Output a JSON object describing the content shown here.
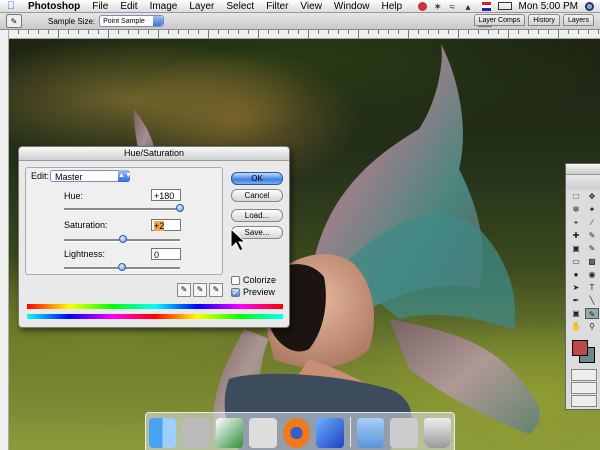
{
  "menubar": {
    "app_name": "Photoshop",
    "items": [
      "File",
      "Edit",
      "Image",
      "Layer",
      "Select",
      "Filter",
      "View",
      "Window",
      "Help"
    ],
    "clock": "Mon 5:00 PM"
  },
  "options_bar": {
    "sample_size_label": "Sample Size:",
    "sample_size_value": "Point Sample"
  },
  "palette_well": {
    "tabs": [
      "Layer Comps",
      "History",
      "Layers"
    ]
  },
  "dialog": {
    "title": "Hue/Saturation",
    "edit_label": "Edit:",
    "edit_value": "Master",
    "hue_label": "Hue:",
    "hue_value": "+180",
    "hue_level": 180,
    "saturation_label": "Saturation:",
    "saturation_value": "+2",
    "saturation_level": 2,
    "lightness_label": "Lightness:",
    "lightness_value": "0",
    "lightness_level": 0,
    "ok_label": "OK",
    "cancel_label": "Cancel",
    "load_label": "Load...",
    "save_label": "Save...",
    "colorize_label": "Colorize",
    "colorize_checked": false,
    "preview_label": "Preview",
    "preview_checked": true
  },
  "colors": {
    "foreground": "#bd4848",
    "background": "#6b8a8a",
    "accent": "#3f7fe0"
  },
  "dock_icons": [
    "finder-icon",
    "system-preferences-icon",
    "mail-icon",
    "scissors-icon",
    "firefox-icon",
    "itunes-icon",
    "folder-icon",
    "applications-icon",
    "trash-icon"
  ]
}
